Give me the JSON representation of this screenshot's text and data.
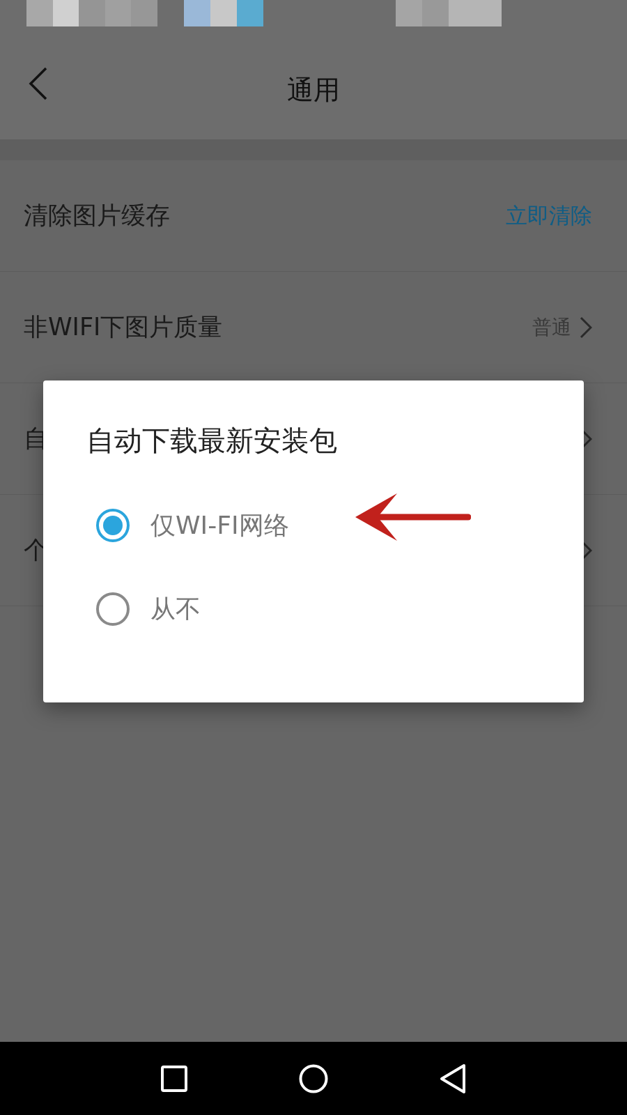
{
  "header": {
    "title": "通用"
  },
  "settings": [
    {
      "label": "清除图片缓存",
      "value": "立即清除",
      "kind": "action"
    },
    {
      "label": "非WIFI下图片质量",
      "value": "普通",
      "kind": "choice"
    },
    {
      "label": "自",
      "kind": "choice"
    },
    {
      "label": "个",
      "kind": "choice"
    }
  ],
  "dialog": {
    "title": "自动下载最新安装包",
    "options": [
      {
        "label": "仅WI-FI网络",
        "selected": true
      },
      {
        "label": "从不",
        "selected": false
      }
    ]
  }
}
